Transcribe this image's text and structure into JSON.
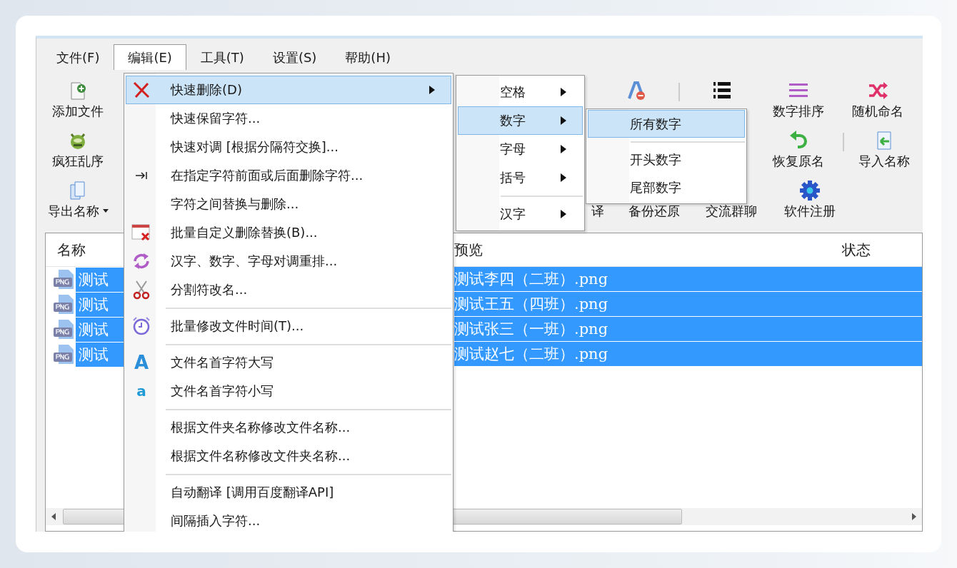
{
  "menu_bar": [
    {
      "label": "文件(F)",
      "selected": false
    },
    {
      "label": "编辑(E)",
      "selected": true
    },
    {
      "label": "工具(T)",
      "selected": false
    },
    {
      "label": "设置(S)",
      "selected": false
    },
    {
      "label": "帮助(H)",
      "selected": false
    }
  ],
  "toolbar": {
    "top_line": [
      {
        "kind": "button",
        "label": "添加文件"
      },
      {
        "kind": "icon"
      },
      {
        "kind": "separator"
      },
      {
        "kind": "icon"
      },
      {
        "kind": "button",
        "label": "数字排序"
      },
      {
        "kind": "button",
        "label": "随机命名"
      }
    ],
    "middle_line": [
      {
        "kind": "button",
        "label": "疯狂乱序"
      },
      {
        "kind": "button",
        "label": "恢复原名"
      },
      {
        "kind": "separator"
      },
      {
        "kind": "button",
        "label": "导入名称"
      }
    ],
    "bottom_line": [
      {
        "kind": "button",
        "label": "导出名称",
        "dropdown": true
      },
      {
        "kind": "label",
        "label": "译"
      },
      {
        "kind": "label",
        "label": "备份还原"
      },
      {
        "kind": "label",
        "label": "交流群聊"
      },
      {
        "kind": "button",
        "label": "软件注册"
      }
    ]
  },
  "file_list": {
    "columns": [
      "名称",
      "预览",
      "状态"
    ],
    "rows": [
      {
        "name": "测试",
        "preview": "测试李四（二班）.png",
        "selected": true
      },
      {
        "name": "测试",
        "preview": "测试王五（四班）.png",
        "selected": true
      },
      {
        "name": "测试",
        "preview": "测试张三（一班）.png",
        "selected": true
      },
      {
        "name": "测试",
        "preview": "测试赵七（二班）.png",
        "selected": true
      }
    ]
  },
  "edit_menu": {
    "items": [
      {
        "kind": "item",
        "label": "快速删除(D)",
        "selected": true,
        "has_submenu": true
      },
      {
        "kind": "item",
        "label": "快速保留字符...",
        "selected": false,
        "has_submenu": false
      },
      {
        "kind": "item",
        "label": "快速对调 [根据分隔符交换]...",
        "selected": false,
        "has_submenu": false
      },
      {
        "kind": "item",
        "label": "在指定字符前面或后面删除字符...",
        "selected": false,
        "has_submenu": false
      },
      {
        "kind": "item",
        "label": "字符之间替换与删除...",
        "selected": false,
        "has_submenu": false
      },
      {
        "kind": "item",
        "label": "批量自定义删除替换(B)...",
        "selected": false,
        "has_submenu": false
      },
      {
        "kind": "item",
        "label": "汉字、数字、字母对调重排...",
        "selected": false,
        "has_submenu": false
      },
      {
        "kind": "item",
        "label": "分割符改名...",
        "selected": false,
        "has_submenu": false
      },
      {
        "kind": "separator"
      },
      {
        "kind": "item",
        "label": "批量修改文件时间(T)...",
        "selected": false,
        "has_submenu": false
      },
      {
        "kind": "separator"
      },
      {
        "kind": "item",
        "label": "文件名首字符大写",
        "icon_text": "A",
        "selected": false,
        "has_submenu": false
      },
      {
        "kind": "item",
        "label": "文件名首字符小写",
        "icon_text": "a",
        "selected": false,
        "has_submenu": false
      },
      {
        "kind": "separator"
      },
      {
        "kind": "item",
        "label": "根据文件夹名称修改文件名称...",
        "selected": false,
        "has_submenu": false
      },
      {
        "kind": "item",
        "label": "根据文件名称修改文件夹名称...",
        "selected": false,
        "has_submenu": false
      },
      {
        "kind": "separator"
      },
      {
        "kind": "item",
        "label": "自动翻译 [调用百度翻译API]",
        "selected": false,
        "has_submenu": false
      },
      {
        "kind": "item",
        "label": "间隔插入字符...",
        "selected": false,
        "has_submenu": false
      }
    ]
  },
  "delete_submenu": {
    "items": [
      {
        "kind": "item",
        "label": "空格",
        "selected": false,
        "has_submenu": true
      },
      {
        "kind": "item",
        "label": "数字",
        "selected": true,
        "has_submenu": true
      },
      {
        "kind": "item",
        "label": "字母",
        "selected": false,
        "has_submenu": true
      },
      {
        "kind": "item",
        "label": "括号",
        "selected": false,
        "has_submenu": true
      },
      {
        "kind": "separator"
      },
      {
        "kind": "item",
        "label": "汉字",
        "selected": false,
        "has_submenu": true
      }
    ]
  },
  "number_submenu": {
    "items": [
      {
        "kind": "item",
        "label": "所有数字",
        "selected": true,
        "has_submenu": false
      },
      {
        "kind": "separator"
      },
      {
        "kind": "item",
        "label": "开头数字",
        "selected": false,
        "has_submenu": false
      },
      {
        "kind": "item",
        "label": "尾部数字",
        "selected": false,
        "has_submenu": false
      }
    ]
  }
}
